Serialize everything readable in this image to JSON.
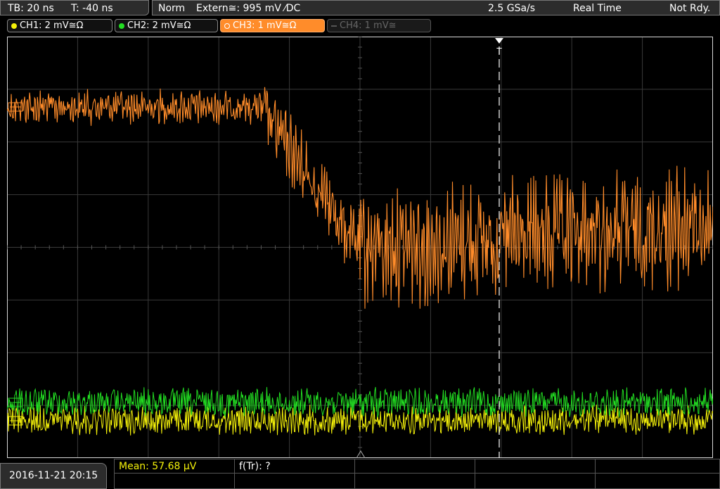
{
  "header": {
    "tb_label": "TB: 20 ns",
    "t_label": "T: -40 ns",
    "mode": "Norm",
    "trigger": "Extern≅: 995 mV ⁄DC",
    "rate": "2.5 GSa/s",
    "acq_mode": "Real Time",
    "status": "Not Rdy."
  },
  "channels": [
    {
      "label": "CH1: 2 mV≅Ω",
      "color": "#f4f10a",
      "active": false
    },
    {
      "label": "CH2: 2 mV≅Ω",
      "color": "#22dd22",
      "active": false
    },
    {
      "label": "CH3: 1 mV≅Ω",
      "color": "#ff8c2a",
      "active": true
    },
    {
      "label": "CH4: 1 mV≅",
      "color": "#777777",
      "active": false,
      "disabled": true
    }
  ],
  "colors": {
    "ch1": "#f4f10a",
    "ch2": "#22dd22",
    "ch3": "#ff8c2a",
    "grid": "#3a3a3a",
    "frame": "#d9d9d9"
  },
  "footer": {
    "datetime": "2016-11-21 20:15",
    "mean": "Mean: 57.68 µV",
    "ftr": "f(Tr): ?"
  },
  "markers": {
    "trigger_marker": "T"
  }
}
